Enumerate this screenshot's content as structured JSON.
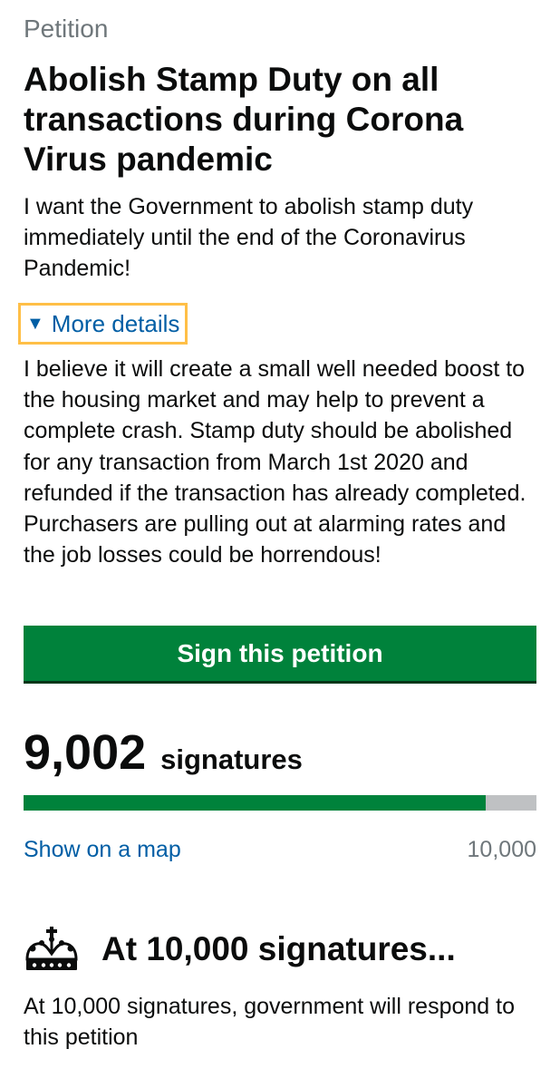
{
  "petition": {
    "caption": "Petition",
    "title": "Abolish Stamp Duty on all transactions during Corona Virus pandemic",
    "summary": "I want the Government to abolish stamp duty immediately until the end of the Coronavirus Pandemic!",
    "details_toggle_label": "More details",
    "details_toggle_icon": "triangle-down",
    "details_text": "I believe it will create a small well needed boost to the housing market and may help to prevent a complete crash. Stamp duty should be abolished for any transaction from March 1st 2020 and refunded if the transaction has already completed. Purchasers are pulling out at alarming rates and the job losses could be horrendous!"
  },
  "actions": {
    "sign_button_label": "Sign this petition"
  },
  "signatures": {
    "count_text": "9,002",
    "count_label": "signatures",
    "count": 9002,
    "target": 10000,
    "threshold_text": "10,000",
    "map_link_label": "Show on a map"
  },
  "milestone": {
    "icon": "crown-icon",
    "heading": "At 10,000 signatures...",
    "text": "At 10,000 signatures, government will respond to this petition"
  },
  "colors": {
    "link": "#005ea5",
    "button": "#00823b",
    "focus": "#ffbf47",
    "progress_track": "#bfc1c3"
  }
}
